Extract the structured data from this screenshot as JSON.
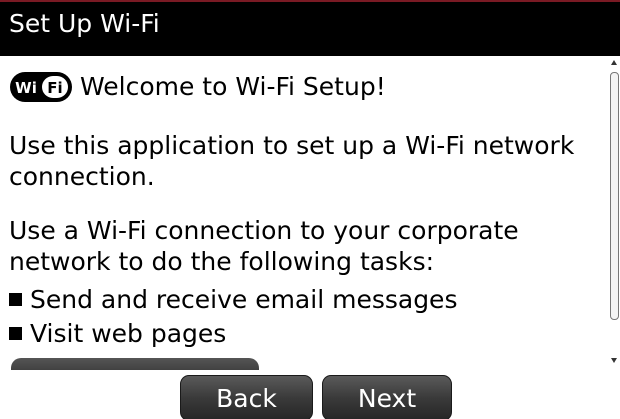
{
  "header": {
    "title": "Set Up Wi-Fi"
  },
  "content": {
    "logo_icon": "wifi-logo-icon",
    "logo_text": "WiFi",
    "welcome": "Welcome to Wi-Fi Setup!",
    "paragraph1": "Use this application to set up a Wi-Fi network connection.",
    "paragraph2": "Use a Wi-Fi connection to your corporate network to do the following tasks:",
    "bullets": [
      "Send and receive email messages",
      "Visit web pages"
    ]
  },
  "footer": {
    "back_label": "Back",
    "next_label": "Next"
  },
  "colors": {
    "titlebar_bg": "#000000",
    "titlebar_text": "#ffffff",
    "button_bg": "#3a3a3a",
    "button_text": "#ffffff"
  }
}
